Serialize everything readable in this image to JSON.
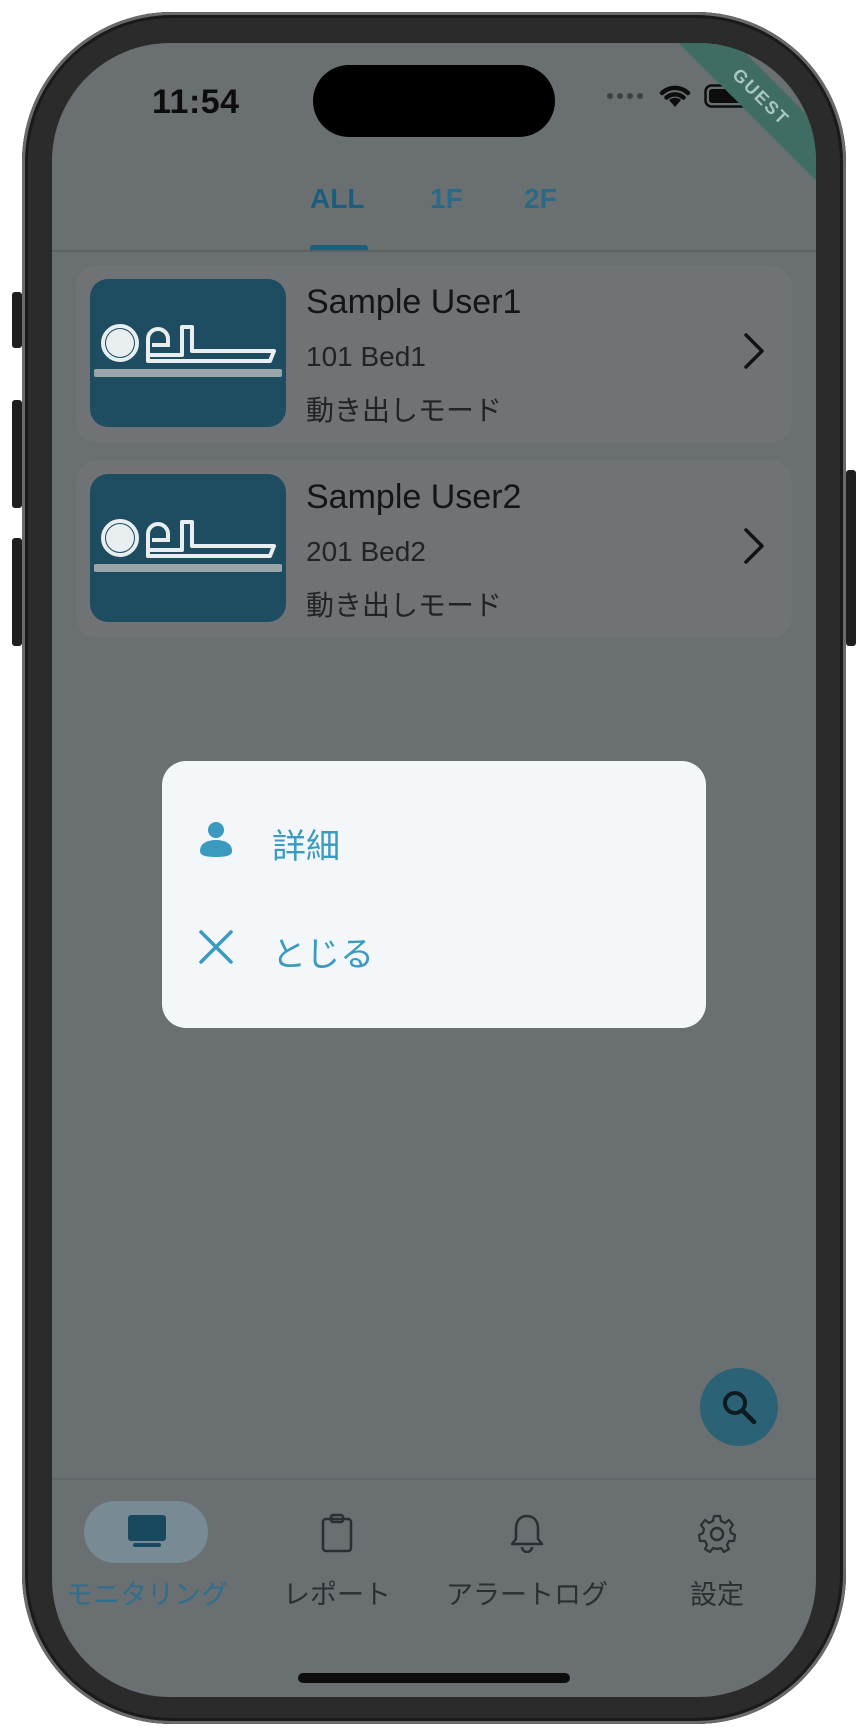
{
  "status_bar": {
    "time": "11:54",
    "guest_label": "GUEST"
  },
  "tabs": [
    {
      "label": "ALL",
      "active": true
    },
    {
      "label": "1F",
      "active": false
    },
    {
      "label": "2F",
      "active": false
    }
  ],
  "users": [
    {
      "name": "Sample User1",
      "bed": "101 Bed1",
      "mode": "動き出しモード"
    },
    {
      "name": "Sample User2",
      "bed": "201 Bed2",
      "mode": "動き出しモード"
    }
  ],
  "dialog": {
    "items": [
      {
        "label": "詳細",
        "icon": "person-icon"
      },
      {
        "label": "とじる",
        "icon": "close-icon"
      }
    ]
  },
  "fab": {
    "icon": "search-icon"
  },
  "bottom_nav": [
    {
      "label": "モニタリング",
      "icon": "monitor-icon",
      "active": true
    },
    {
      "label": "レポート",
      "icon": "clipboard-icon",
      "active": false
    },
    {
      "label": "アラートログ",
      "icon": "bell-icon",
      "active": false
    },
    {
      "label": "設定",
      "icon": "gear-icon",
      "active": false
    }
  ],
  "colors": {
    "accent": "#3a9ac0",
    "thumb_bg": "#1e4d62",
    "scrim": "#6a6f72",
    "dialog_bg": "#f3f7fa"
  }
}
